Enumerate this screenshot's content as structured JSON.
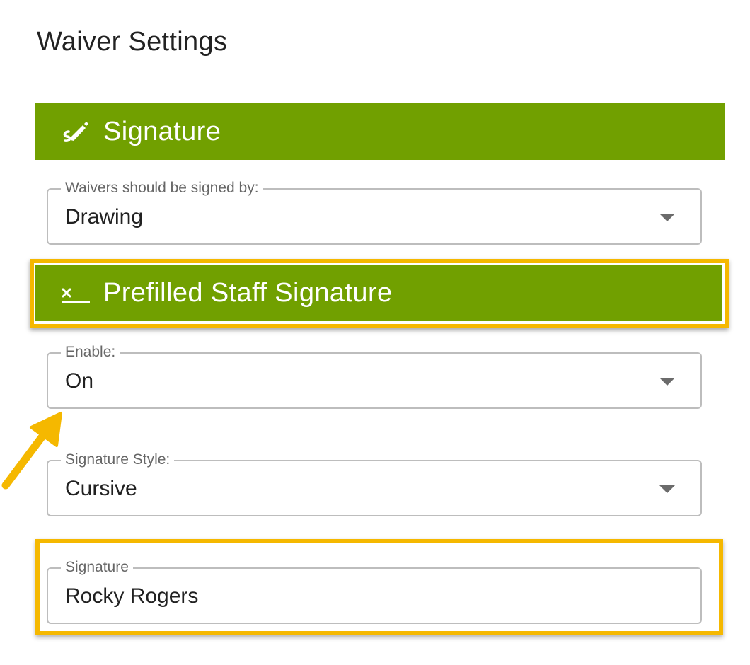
{
  "page": {
    "title": "Waiver Settings"
  },
  "sections": {
    "signature": {
      "label": "Signature",
      "icon": "signature-pen-icon"
    },
    "prefilled": {
      "label": "Prefilled Staff Signature",
      "icon": "signature-line-icon"
    }
  },
  "fields": {
    "signed_by": {
      "label": "Waivers should be signed by:",
      "value": "Drawing"
    },
    "enable": {
      "label": "Enable:",
      "value": "On"
    },
    "signature_style": {
      "label": "Signature Style:",
      "value": "Cursive"
    },
    "signature": {
      "label": "Signature",
      "value": "Rocky Rogers"
    }
  },
  "colors": {
    "header_green": "#71a000",
    "highlight": "#f5b800",
    "arrow": "#f5b800"
  }
}
